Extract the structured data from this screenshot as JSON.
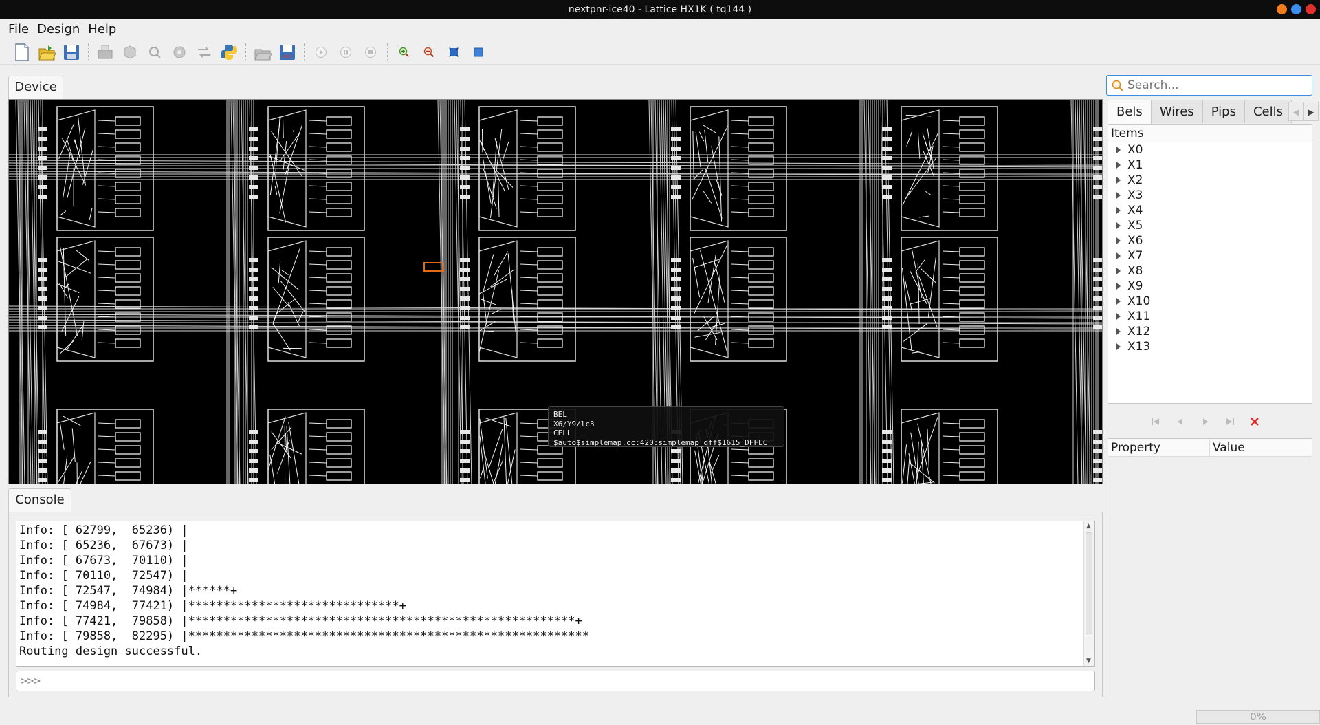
{
  "window": {
    "title": "nextpnr-ice40 - Lattice HX1K ( tq144 )",
    "controls": [
      {
        "name": "minimize",
        "color": "#f07d1c"
      },
      {
        "name": "maximize",
        "color": "#3c8ded"
      },
      {
        "name": "close",
        "color": "#e0302e"
      }
    ]
  },
  "menubar": {
    "items": [
      "File",
      "Design",
      "Help"
    ]
  },
  "toolbar": {
    "buttons": [
      "new-file-icon",
      "open-folder-icon",
      "save-icon",
      "sep",
      "load-json-icon",
      "pack-icon",
      "place-icon",
      "route-icon",
      "assign-budget-icon",
      "python-icon",
      "sep",
      "open-pcf-icon",
      "save-asc-icon",
      "sep",
      "play-icon",
      "pause-icon",
      "stop-icon",
      "sep",
      "zoom-in-icon",
      "zoom-out-icon",
      "zoom-fit-icon",
      "zoom-selected-icon"
    ]
  },
  "device": {
    "tab_label": "Device",
    "tooltip": "BEL\nX6/Y9/lc3\nCELL\n$auto$simplemap.cc:420:simplemap_dff$1615_DFFLC"
  },
  "console": {
    "tab_label": "Console",
    "lines": [
      "Info: [ 62799,  65236) |",
      "Info: [ 65236,  67673) |",
      "Info: [ 67673,  70110) |",
      "Info: [ 70110,  72547) |",
      "Info: [ 72547,  74984) |******+",
      "Info: [ 74984,  77421) |******************************+",
      "Info: [ 77421,  79858) |*******************************************************+",
      "Info: [ 79858,  82295) |*********************************************************",
      "Routing design successful."
    ],
    "prompt": ">>>"
  },
  "sidebar": {
    "search_placeholder": "Search...",
    "tabs": [
      "Bels",
      "Wires",
      "Pips",
      "Cells"
    ],
    "active_tab": "Bels",
    "items_header": "Items",
    "items": [
      "X0",
      "X1",
      "X2",
      "X3",
      "X4",
      "X5",
      "X6",
      "X7",
      "X8",
      "X9",
      "X10",
      "X11",
      "X12",
      "X13"
    ],
    "nav_buttons": [
      "first-icon",
      "prev-icon",
      "next-icon",
      "last-icon",
      "clear-icon"
    ],
    "property_header": "Property",
    "value_header": "Value"
  },
  "status": {
    "progress": "0%",
    "progress_value": 0
  }
}
